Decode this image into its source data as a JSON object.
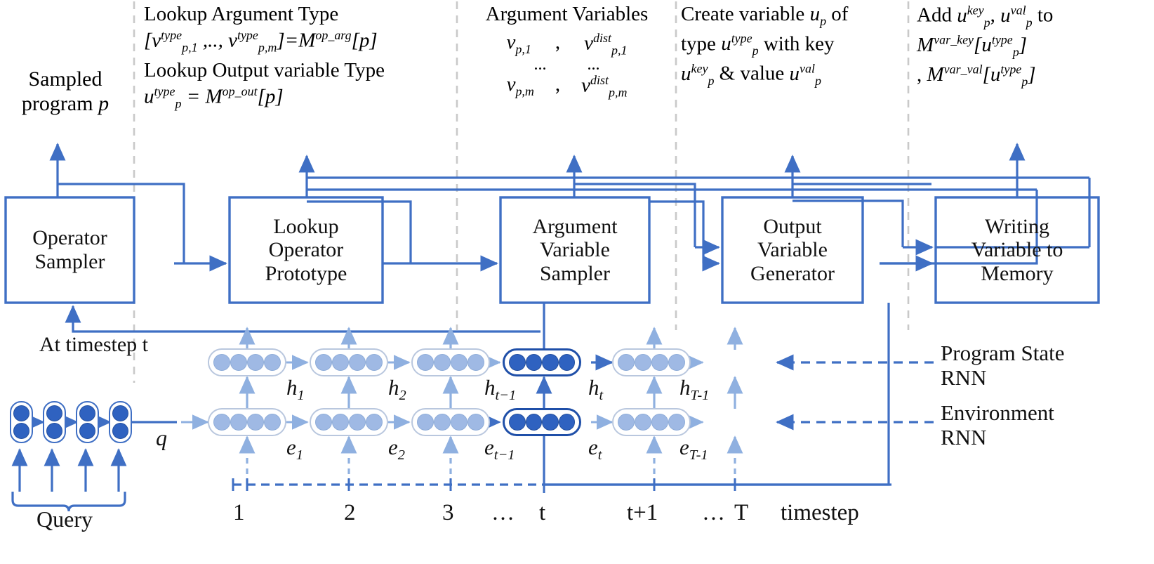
{
  "figure": {
    "type": "architecture-diagram",
    "accent_color": "#3f6fc4",
    "dashed_divider_color": "#c9c9c9",
    "dark_node_color": "#2f62c0",
    "light_node_color": "#9fb9e4"
  },
  "columns": [
    {
      "id": "sampled-program",
      "lines": [
        "Sampled",
        "program p"
      ]
    },
    {
      "id": "lookup-argument-type",
      "lines": [
        "Lookup Argument Type",
        "[v^type_p,1 ,.., v^type_p,m ]=M^op_arg[p]",
        "Lookup Output variable Type",
        "u^type_p = M^op_out[p]"
      ]
    },
    {
      "id": "argument-variables",
      "title": "Argument Variables",
      "rows": [
        [
          "v_p,1",
          "v^dist_p,1"
        ],
        [
          "...",
          "..."
        ],
        [
          "v_p,m",
          "v^dist_p,m"
        ]
      ]
    },
    {
      "id": "create-variable",
      "lines": [
        "Create variable u_p of",
        "type u^type_p with key",
        "u^key_p & value u^val_p"
      ]
    },
    {
      "id": "add-to-memory",
      "lines": [
        "Add u^key_p , u^val_p to",
        "M^var_key[u^type_p]",
        ", M^var_val[u^type_p]"
      ]
    }
  ],
  "boxes": [
    {
      "id": "operator-sampler",
      "label": "Operator\nSampler"
    },
    {
      "id": "lookup-operator-prototype",
      "label": "Lookup\nOperator\nPrototype"
    },
    {
      "id": "argument-variable-sampler",
      "label": "Argument\nVariable\nSampler"
    },
    {
      "id": "output-variable-generator",
      "label": "Output\nVariable\nGenerator"
    },
    {
      "id": "writing-variable-to-memory",
      "label": "Writing\nVariable to\nMemory"
    }
  ],
  "annotations": {
    "at_timestep": "At timestep t",
    "query": "Query",
    "q_symbol": "q",
    "program_state_rnn": "Program State\nRNN",
    "environment_rnn": "Environment\nRNN",
    "timestep_axis_label": "timestep"
  },
  "hidden_state_labels": [
    "h₁",
    "h₂",
    "hₜ₋₁",
    "hₜ",
    "hᴛ₋₁"
  ],
  "hidden_state_labels_text": [
    "h1",
    "h2",
    "ht-1",
    "ht",
    "hT-1"
  ],
  "env_state_labels_text": [
    "e1",
    "e2",
    "et-1",
    "et",
    "eT-1"
  ],
  "timesteps": [
    "1",
    "2",
    "3",
    "…",
    "t",
    "t+1",
    "…",
    "T"
  ],
  "rnn": {
    "cells_per_row": 5,
    "units_per_cell": 4,
    "highlighted_index": 3,
    "query_cells": 4,
    "query_units_per_cell": 2,
    "rows": [
      {
        "name": "program-state-rnn"
      },
      {
        "name": "environment-rnn"
      }
    ]
  }
}
